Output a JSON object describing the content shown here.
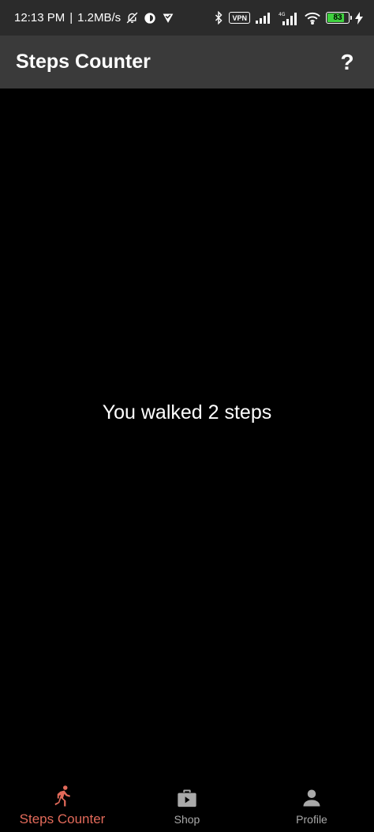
{
  "status_bar": {
    "time": "12:13 PM",
    "separator": "|",
    "speed": "1.2MB/s",
    "vpn": "VPN",
    "battery": 83,
    "battery_label": "83",
    "icons_left": [
      "bell-off-icon",
      "data-saver-icon",
      "check-shield-icon"
    ],
    "icons_right": [
      "bluetooth-icon",
      "vpn-icon",
      "signal-icon",
      "signal-4g-icon",
      "wifi-icon",
      "battery-icon",
      "charging-icon"
    ]
  },
  "app_bar": {
    "title": "Steps Counter",
    "help_label": "?"
  },
  "main": {
    "steps_message": "You walked 2 steps"
  },
  "bottom_nav": {
    "items": [
      {
        "label": "Steps Counter",
        "icon": "running-person-icon",
        "active": true
      },
      {
        "label": "Shop",
        "icon": "shopping-bag-icon",
        "active": false
      },
      {
        "label": "Profile",
        "icon": "person-icon",
        "active": false
      }
    ]
  },
  "colors": {
    "status_bar_bg": "#2b2b2b",
    "app_bar_bg": "#3a3a3a",
    "background": "#000000",
    "accent": "#e26a5a",
    "inactive": "#a9a9a9",
    "battery": "#3fd13f"
  }
}
